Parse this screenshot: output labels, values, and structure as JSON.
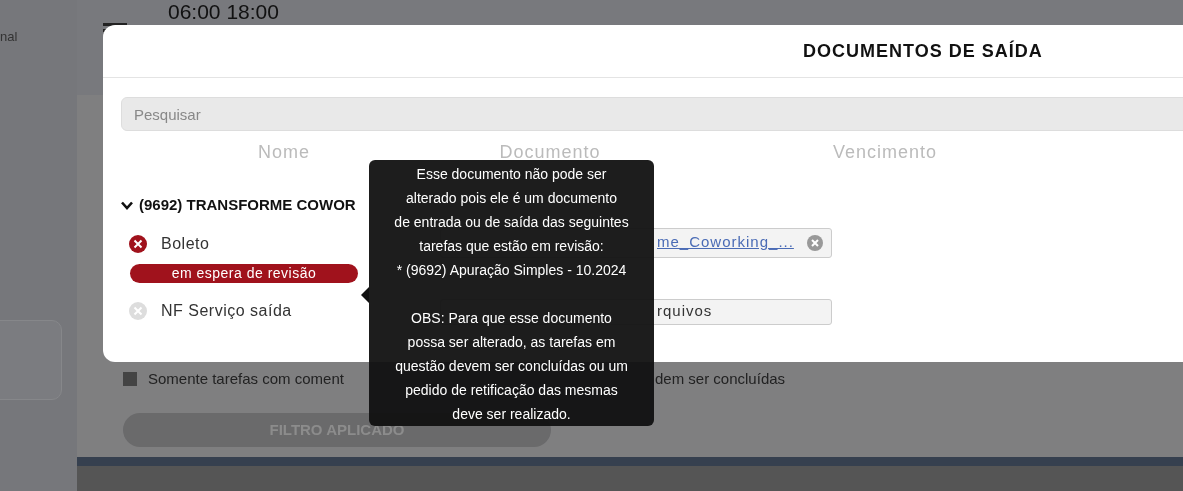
{
  "background": {
    "sidebar_text": "nal",
    "time_range": "06:00 18:00",
    "filters": [
      {
        "label": "Somente tarefas com coment",
        "checked": false
      },
      {
        "label": "dem ser concluídas"
      }
    ],
    "filter_button": "FILTRO APLICADO"
  },
  "modal": {
    "title": "DOCUMENTOS DE SAÍDA",
    "search": {
      "placeholder": "Pesquisar"
    },
    "columns": [
      "Nome",
      "Documento",
      "Vencimento"
    ],
    "group": {
      "title": "(9692) TRANSFORME COWOR",
      "expanded": true,
      "documents": [
        {
          "name": "Boleto",
          "kind": "error",
          "badge": "em espera de revisão",
          "file": {
            "kind": "link",
            "text": "me_Coworking_..."
          }
        },
        {
          "name": "NF Serviço saída",
          "kind": "empty",
          "file": {
            "kind": "upload",
            "text": "rquivos"
          }
        }
      ]
    }
  },
  "tooltip": {
    "paragraphs": [
      "Esse documento não pode ser\nalterado pois ele é um documento\nde entrada ou de saída das seguintes\ntarefas que estão em revisão:\n* (9692) Apuração Simples - 10.2024",
      "OBS: Para que esse documento\npossa ser alterado, as tarefas em\nquestão devem ser concluídas ou um\npedido de retificação das mesmas\ndeve ser realizado."
    ]
  }
}
